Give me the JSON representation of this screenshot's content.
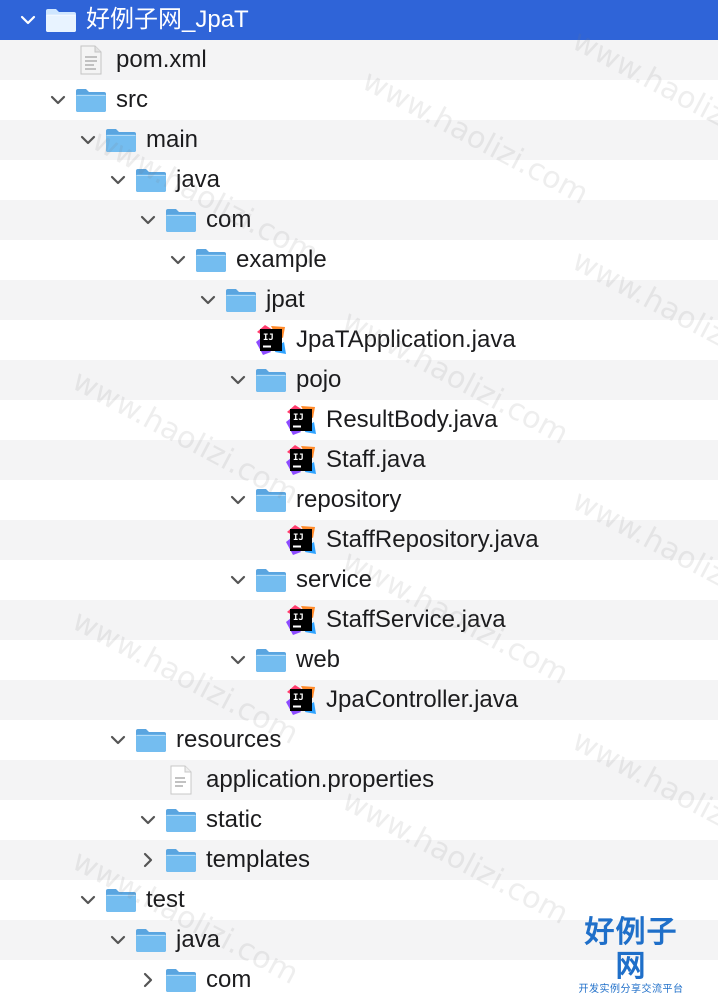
{
  "tree": {
    "items": [
      {
        "label": "好例子网_JpaT",
        "type": "folder",
        "depth": 0,
        "expanded": true,
        "selected": true
      },
      {
        "label": "pom.xml",
        "type": "xml",
        "depth": 1
      },
      {
        "label": "src",
        "type": "folder",
        "depth": 1,
        "expanded": true
      },
      {
        "label": "main",
        "type": "folder",
        "depth": 2,
        "expanded": true
      },
      {
        "label": "java",
        "type": "folder",
        "depth": 3,
        "expanded": true
      },
      {
        "label": "com",
        "type": "folder",
        "depth": 4,
        "expanded": true
      },
      {
        "label": "example",
        "type": "folder",
        "depth": 5,
        "expanded": true
      },
      {
        "label": "jpat",
        "type": "folder",
        "depth": 6,
        "expanded": true
      },
      {
        "label": "JpaTApplication.java",
        "type": "java",
        "depth": 7
      },
      {
        "label": "pojo",
        "type": "folder",
        "depth": 7,
        "expanded": true
      },
      {
        "label": "ResultBody.java",
        "type": "java",
        "depth": 8
      },
      {
        "label": "Staff.java",
        "type": "java",
        "depth": 8
      },
      {
        "label": "repository",
        "type": "folder",
        "depth": 7,
        "expanded": true
      },
      {
        "label": "StaffRepository.java",
        "type": "java",
        "depth": 8
      },
      {
        "label": "service",
        "type": "folder",
        "depth": 7,
        "expanded": true
      },
      {
        "label": "StaffService.java",
        "type": "java",
        "depth": 8
      },
      {
        "label": "web",
        "type": "folder",
        "depth": 7,
        "expanded": true
      },
      {
        "label": "JpaController.java",
        "type": "java",
        "depth": 8
      },
      {
        "label": "resources",
        "type": "folder",
        "depth": 3,
        "expanded": true
      },
      {
        "label": "application.properties",
        "type": "text",
        "depth": 4
      },
      {
        "label": "static",
        "type": "folder",
        "depth": 4,
        "expanded": true
      },
      {
        "label": "templates",
        "type": "folder",
        "depth": 4,
        "expanded": false
      },
      {
        "label": "test",
        "type": "folder",
        "depth": 2,
        "expanded": true
      },
      {
        "label": "java",
        "type": "folder",
        "depth": 3,
        "expanded": true
      },
      {
        "label": "com",
        "type": "folder",
        "depth": 4,
        "expanded": false
      }
    ]
  },
  "watermark": {
    "text": "www.haolizi.com",
    "logo_main": "好例子网",
    "logo_sub": "开发实例分享交流平台"
  },
  "colors": {
    "selection": "#2f64d8",
    "folder": "#6cb4e8",
    "java_badge": "#000000"
  }
}
